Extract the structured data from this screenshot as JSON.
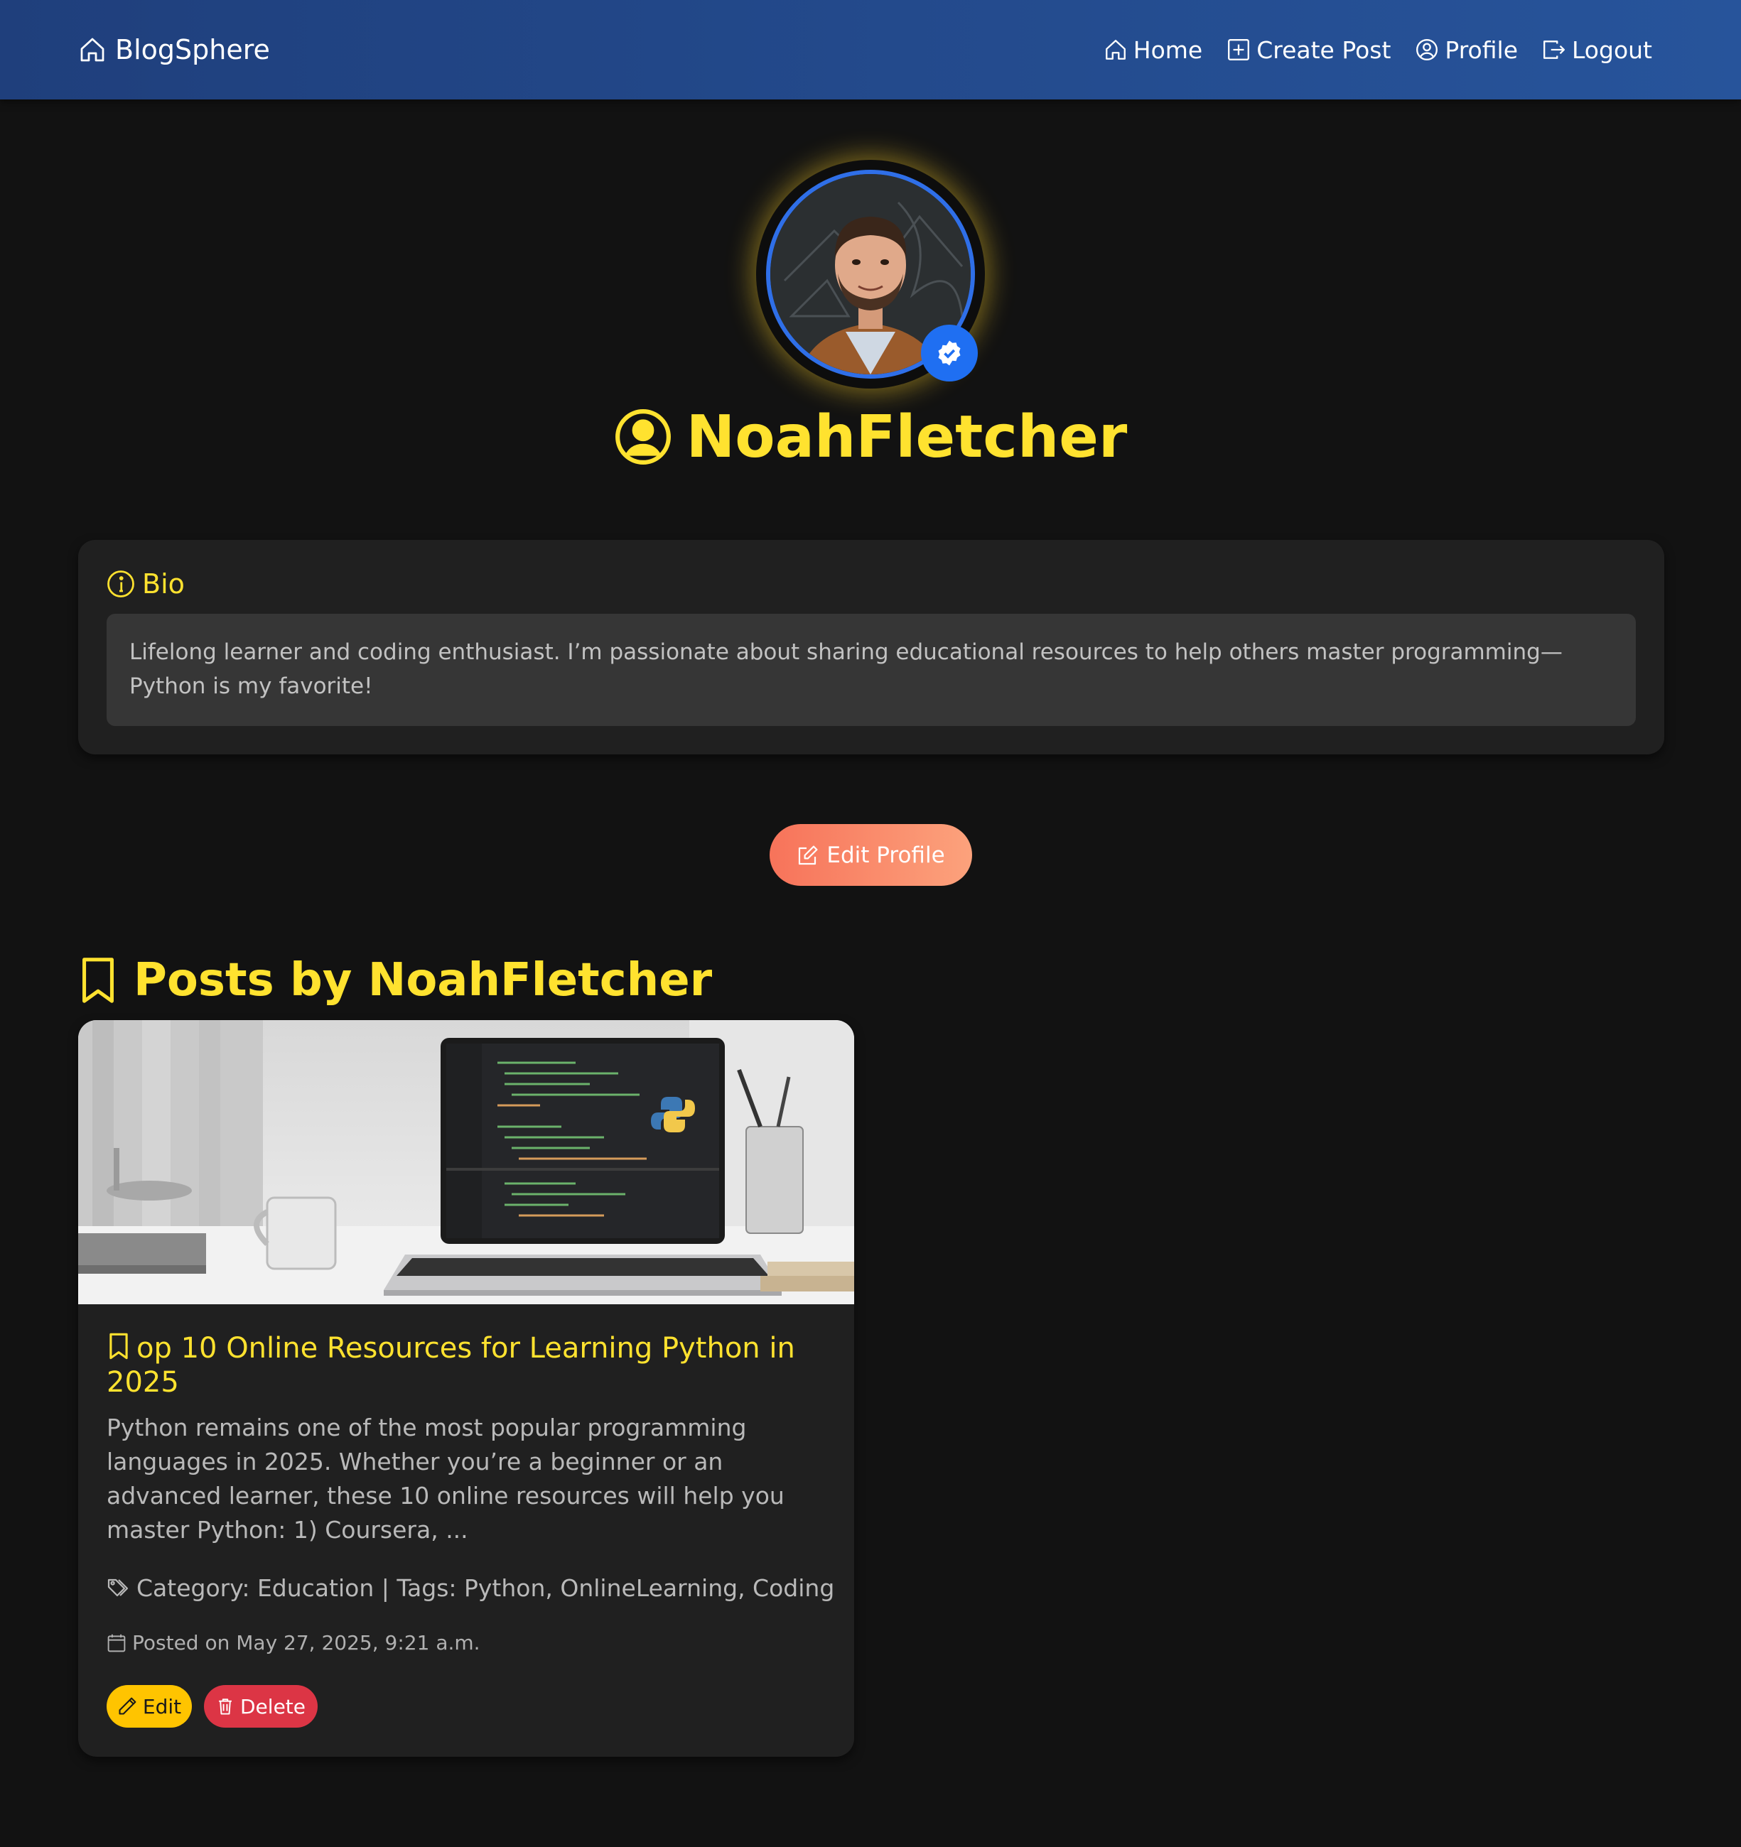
{
  "nav": {
    "brand": "BlogSphere",
    "links": [
      {
        "label": "Home",
        "icon": "house-icon"
      },
      {
        "label": "Create Post",
        "icon": "plus-square-icon"
      },
      {
        "label": "Profile",
        "icon": "person-circle-icon"
      },
      {
        "label": "Logout",
        "icon": "box-arrow-right-icon"
      }
    ]
  },
  "profile": {
    "username": "NoahFletcher",
    "verified_icon": "patch-check-icon"
  },
  "bio": {
    "heading": "Bio",
    "text": "Lifelong learner and coding enthusiast. I’m passionate about sharing educational resources to help others master programming—Python is my favorite!"
  },
  "actions": {
    "edit_profile": "Edit Profile"
  },
  "posts": {
    "heading": "Posts by NoahFletcher",
    "items": [
      {
        "title": "op 10 Online Resources for Learning Python in 2025",
        "excerpt": "Python remains one of the most popular programming languages in 2025. Whether you’re a beginner or an advanced learner, these 10 online resources will help you master Python: 1) Coursera, ...",
        "meta": "Category: Education | Tags: Python, OnlineLearning, Coding",
        "date": "Posted on May 27, 2025, 9:21 a.m.",
        "edit_label": "Edit",
        "delete_label": "Delete"
      }
    ]
  },
  "colors": {
    "accent": "#ffe22f",
    "nav_start": "#1f3f7c",
    "nav_end": "#27549b",
    "edit_button": "#ffc400",
    "delete_button": "#dc3545",
    "edit_profile_start": "#f7735a",
    "edit_profile_end": "#fca27c",
    "verified_badge": "#1f6ff2"
  }
}
